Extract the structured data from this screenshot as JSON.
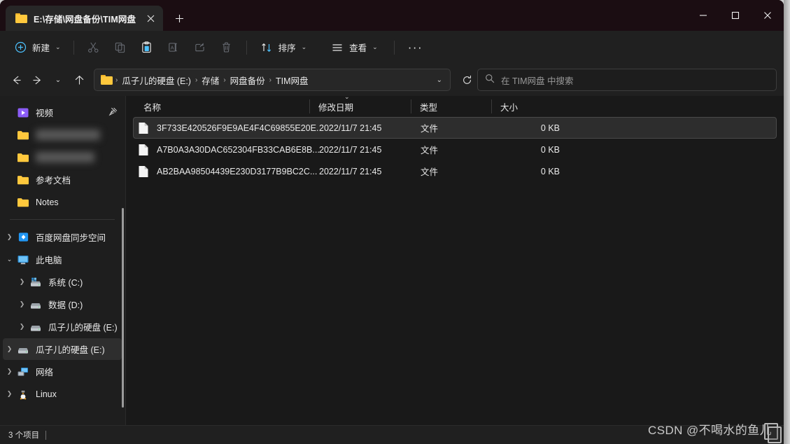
{
  "window": {
    "tab": {
      "title": "E:\\存储\\网盘备份\\TIM网盘",
      "folder_icon": "folder-icon",
      "close_icon": "close-icon"
    },
    "new_tab_label": "+",
    "controls": {
      "minimize": "minimize-icon",
      "maximize": "maximize-icon",
      "close": "close-icon"
    }
  },
  "toolbar": {
    "new_label": "新建",
    "sort_label": "排序",
    "view_label": "查看",
    "more_label": "···",
    "items": [
      {
        "name": "cut-icon",
        "enabled": false
      },
      {
        "name": "copy-icon",
        "enabled": false
      },
      {
        "name": "paste-icon",
        "enabled": true
      },
      {
        "name": "rename-icon",
        "enabled": false
      },
      {
        "name": "share-icon",
        "enabled": false
      },
      {
        "name": "delete-icon",
        "enabled": false
      }
    ]
  },
  "address": {
    "back": "←",
    "forward": "→",
    "recent": "⌄",
    "up": "↑",
    "crumbs": [
      "瓜子儿的硬盘 (E:)",
      "存储",
      "网盘备份",
      "TIM网盘"
    ],
    "separator": "›",
    "dropdown": "⌄",
    "refresh": "↻"
  },
  "search": {
    "placeholder": "在 TIM网盘 中搜索",
    "icon": "search-icon"
  },
  "sidebar": {
    "pinned": [
      {
        "label": "视频",
        "icon": "video-icon",
        "pin": "📌",
        "blurred": false,
        "expandable": false,
        "indent": false
      },
      {
        "label": "",
        "icon": "folder-icon",
        "blurred": true,
        "expandable": false,
        "indent": false
      },
      {
        "label": "",
        "icon": "folder-icon",
        "blurred": true,
        "expandable": false,
        "indent": false
      },
      {
        "label": "参考文档",
        "icon": "folder-icon",
        "blurred": false,
        "expandable": false,
        "indent": false
      },
      {
        "label": "Notes",
        "icon": "folder-icon",
        "blurred": false,
        "expandable": false,
        "indent": false
      }
    ],
    "tree": [
      {
        "label": "百度网盘同步空间",
        "icon": "baidu-netdisk-icon",
        "expandable": true,
        "expanded": false,
        "indent": false,
        "selected": false
      },
      {
        "label": "此电脑",
        "icon": "this-pc-icon",
        "expandable": true,
        "expanded": true,
        "indent": false,
        "selected": false
      },
      {
        "label": "系统 (C:)",
        "icon": "system-drive-icon",
        "expandable": true,
        "expanded": false,
        "indent": true,
        "selected": false
      },
      {
        "label": "数据 (D:)",
        "icon": "drive-icon",
        "expandable": true,
        "expanded": false,
        "indent": true,
        "selected": false
      },
      {
        "label": "瓜子儿的硬盘 (E:)",
        "icon": "drive-icon",
        "expandable": true,
        "expanded": false,
        "indent": true,
        "selected": false
      },
      {
        "label": "瓜子儿的硬盘 (E:)",
        "icon": "drive-icon",
        "expandable": true,
        "expanded": false,
        "indent": false,
        "selected": true
      },
      {
        "label": "网络",
        "icon": "network-icon",
        "expandable": true,
        "expanded": false,
        "indent": false,
        "selected": false
      },
      {
        "label": "Linux",
        "icon": "linux-icon",
        "expandable": true,
        "expanded": false,
        "indent": false,
        "selected": false
      }
    ]
  },
  "filelist": {
    "columns": [
      "名称",
      "修改日期",
      "类型",
      "大小"
    ],
    "sort_column": "修改日期",
    "sort_indicator": "⌄",
    "rows": [
      {
        "name": "3F733E420526F9E9AE4F4C69855E20E...",
        "date": "2022/11/7 21:45",
        "type": "文件",
        "size": "0 KB",
        "focused": true
      },
      {
        "name": "A7B0A3A30DAC652304FB33CAB6E8B...",
        "date": "2022/11/7 21:45",
        "type": "文件",
        "size": "0 KB",
        "focused": false
      },
      {
        "name": "AB2BAA98504439E230D3177B9BC2C...",
        "date": "2022/11/7 21:45",
        "type": "文件",
        "size": "0 KB",
        "focused": false
      }
    ]
  },
  "statusbar": {
    "item_count": "3 个项目"
  },
  "watermark": {
    "text": "CSDN @不喝水的鱼儿"
  },
  "colors": {
    "titlebar": "#1b0d12",
    "toolbar": "#202020",
    "sidebar": "#1e1e1e",
    "content": "#191919",
    "accent": "#4cc2ff",
    "folder": "#ffc83d"
  }
}
